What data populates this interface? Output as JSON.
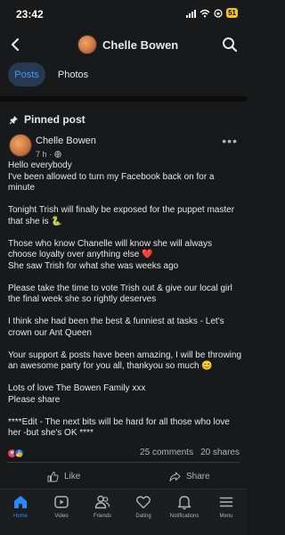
{
  "status_bar": {
    "time": "23:42",
    "battery": "51"
  },
  "header": {
    "title": "Chelle Bowen"
  },
  "tabs": [
    {
      "label": "Posts"
    },
    {
      "label": "Photos"
    }
  ],
  "pinned_label": "Pinned post",
  "post": {
    "author": "Chelle Bowen",
    "time": "7 h ·",
    "paragraphs": [
      "Hello everybody\nI've been allowed to turn my Facebook back on for a minute",
      "Tonight Trish will finally be exposed for the puppet master that she is 🐍",
      "Those who know Chanelle will know she will always choose loyalty over anything else ❤️\nShe saw Trish for what she was weeks ago",
      "Please take the time to vote Trish out & give our local girl the final week she so rightly deserves",
      "I think she had been the best & funniest at tasks - Let's crown our Ant Queen",
      "Your support & posts have been amazing, I will be throwing an awesome party for you all, thankyou so much 😊",
      "Lots of love The Bowen Family xxx\nPlease share",
      "****Edit - The next bits will be hard for all those who love her -but she's OK ****"
    ],
    "comments": "25 comments",
    "shares": "20 shares"
  },
  "actions": {
    "like": "Like",
    "share": "Share"
  },
  "nav": [
    {
      "label": "Home",
      "icon": "home-icon"
    },
    {
      "label": "Video",
      "icon": "video-icon"
    },
    {
      "label": "Friends",
      "icon": "friends-icon"
    },
    {
      "label": "Dating",
      "icon": "dating-icon"
    },
    {
      "label": "Notifications",
      "icon": "bell-icon"
    },
    {
      "label": "Menu",
      "icon": "menu-icon"
    }
  ],
  "colors": {
    "accent": "#2d88ff",
    "background": "#18191a",
    "love": "#f33e58",
    "like": "#1877f2"
  }
}
